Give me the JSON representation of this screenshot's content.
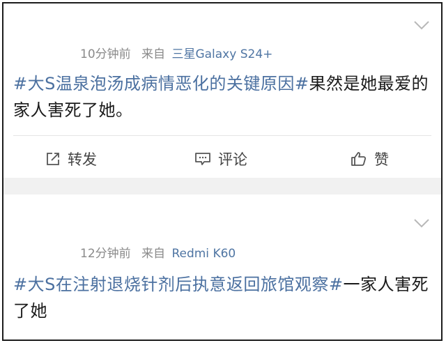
{
  "posts": [
    {
      "time": "10分钟前",
      "source_prefix": "来自",
      "device": "三星Galaxy S24+",
      "topic": "#大S温泉泡汤成病情恶化的关键原因#",
      "body": "果然是她最爱的家人害死了她。"
    },
    {
      "time": "12分钟前",
      "source_prefix": "来自",
      "device": "Redmi K60",
      "topic": "#大S在注射退烧针剂后执意返回旅馆观察#",
      "body": "一家人害死了她"
    }
  ],
  "actions": {
    "share": "转发",
    "comment": "评论",
    "like": "赞"
  },
  "icons": [
    "chevron-down-icon",
    "share-icon",
    "comment-icon",
    "thumbs-up-icon"
  ],
  "colors": {
    "topic": "#4b70a0",
    "meta": "#8a8a8a",
    "separator": "#f1f1f1"
  }
}
